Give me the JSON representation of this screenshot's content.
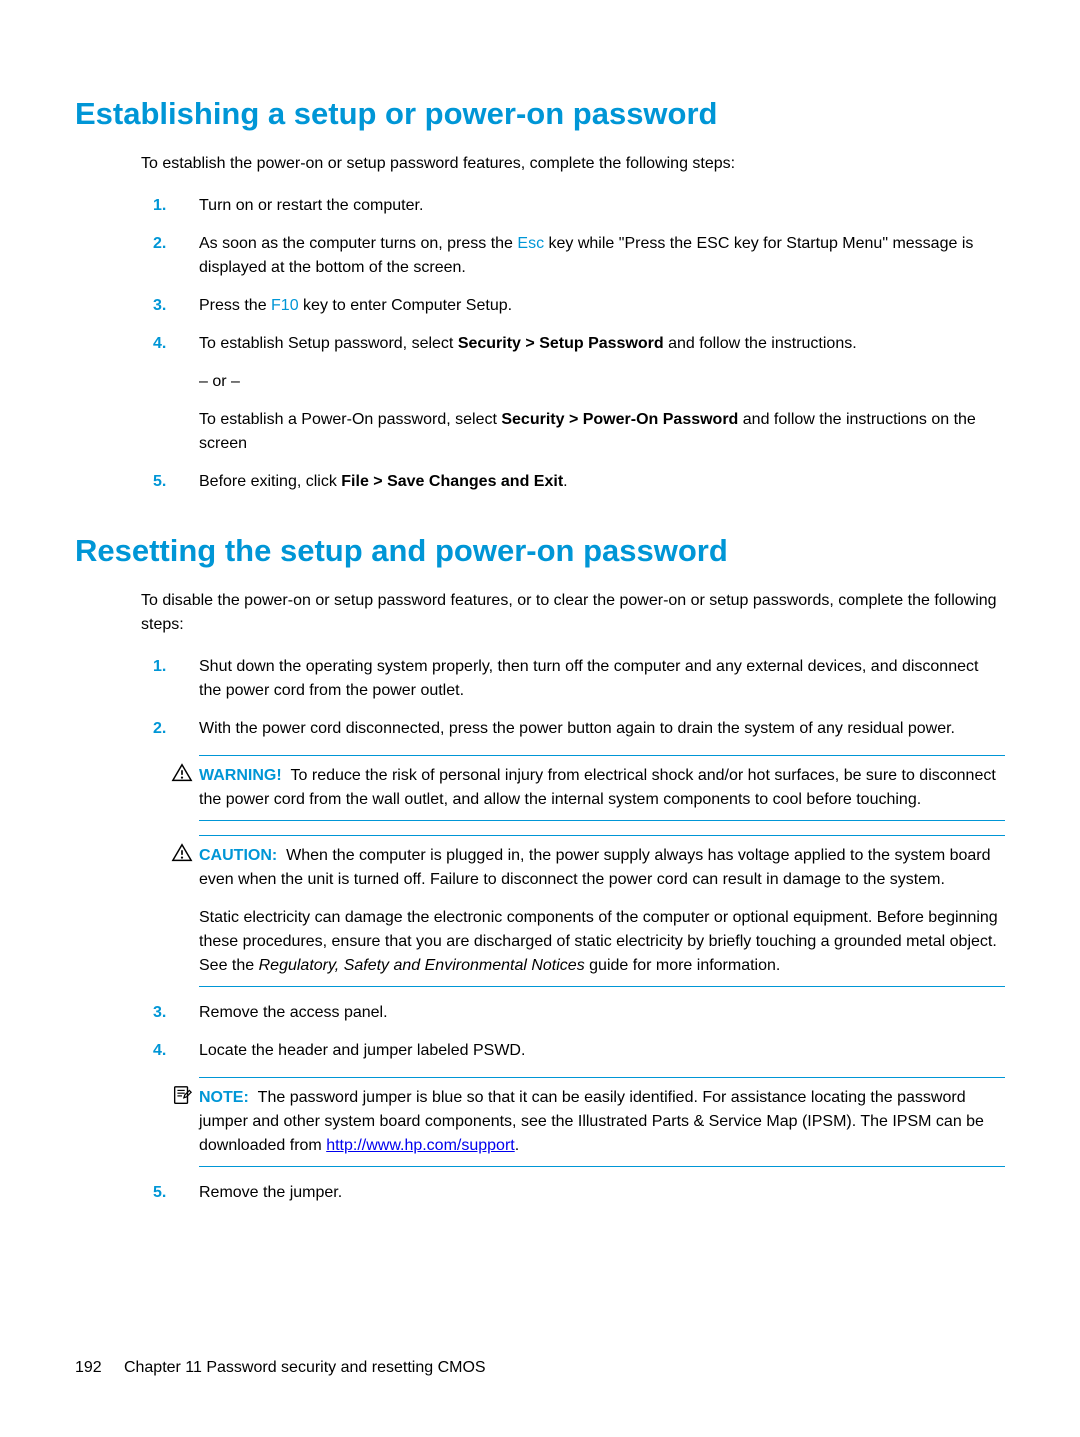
{
  "section1": {
    "heading": "Establishing a setup or power-on password",
    "intro": "To establish the power-on or setup password features, complete the following steps:",
    "steps": [
      {
        "num": "1.",
        "text": "Turn on or restart the computer."
      },
      {
        "num": "2.",
        "parts": [
          {
            "t": "As soon as the computer turns on, press the "
          },
          {
            "t": "Esc",
            "cls": "blue-text"
          },
          {
            "t": " key while \"Press the ESC key for Startup Menu\" message is displayed at the bottom of the screen."
          }
        ]
      },
      {
        "num": "3.",
        "parts": [
          {
            "t": "Press the "
          },
          {
            "t": "F10",
            "cls": "blue-text"
          },
          {
            "t": " key to enter Computer Setup."
          }
        ]
      },
      {
        "num": "4.",
        "parts": [
          {
            "t": "To establish Setup password, select "
          },
          {
            "t": "Security > Setup Password",
            "cls": "bold"
          },
          {
            "t": " and follow the instructions."
          }
        ],
        "sub": [
          {
            "parts": [
              {
                "t": "– or –"
              }
            ]
          },
          {
            "parts": [
              {
                "t": "To establish a Power-On password, select "
              },
              {
                "t": "Security > Power-On Password",
                "cls": "bold"
              },
              {
                "t": " and follow the instructions on the screen"
              }
            ]
          }
        ]
      },
      {
        "num": "5.",
        "parts": [
          {
            "t": "Before exiting, click "
          },
          {
            "t": "File > Save Changes and Exit",
            "cls": "bold"
          },
          {
            "t": "."
          }
        ]
      }
    ]
  },
  "section2": {
    "heading": "Resetting the setup and power-on password",
    "intro": "To disable the power-on or setup password features, or to clear the power-on or setup passwords, complete the following steps:",
    "steps": [
      {
        "num": "1.",
        "text": "Shut down the operating system properly, then turn off the computer and any external devices, and disconnect the power cord from the power outlet."
      },
      {
        "num": "2.",
        "text": "With the power cord disconnected, press the power button again to drain the system of any residual power.",
        "alerts": [
          {
            "type": "warning",
            "title": "WARNING!",
            "body": "To reduce the risk of personal injury from electrical shock and/or hot surfaces, be sure to disconnect the power cord from the wall outlet, and allow the internal system components to cool before touching."
          },
          {
            "type": "caution",
            "title": "CAUTION:",
            "body": "When the computer is plugged in, the power supply always has voltage applied to the system board even when the unit is turned off. Failure to disconnect the power cord can result in damage to the system.",
            "extraParts": [
              {
                "t": "Static electricity can damage the electronic components of the computer or optional equipment. Before beginning these procedures, ensure that you are discharged of static electricity by briefly touching a grounded metal object. See the "
              },
              {
                "t": "Regulatory, Safety and Environmental Notices",
                "cls": "italic"
              },
              {
                "t": " guide for more information."
              }
            ]
          }
        ]
      },
      {
        "num": "3.",
        "text": "Remove the access panel."
      },
      {
        "num": "4.",
        "text": "Locate the header and jumper labeled PSWD.",
        "alerts": [
          {
            "type": "note",
            "title": "NOTE:",
            "bodyParts": [
              {
                "t": "The password jumper is blue so that it can be easily identified. For assistance locating the password jumper and other system board components, see the Illustrated Parts & Service Map (IPSM). The IPSM can be downloaded from "
              },
              {
                "t": "http://www.hp.com/support",
                "cls": "link"
              },
              {
                "t": "."
              }
            ]
          }
        ]
      },
      {
        "num": "5.",
        "text": "Remove the jumper."
      }
    ]
  },
  "footer": {
    "pagenum": "192",
    "chapter": "Chapter 11   Password security and resetting CMOS"
  }
}
